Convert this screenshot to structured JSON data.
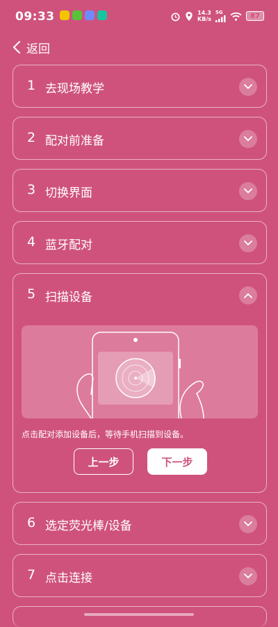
{
  "status_bar": {
    "time": "09:33",
    "net_speed_value": "14.3",
    "net_speed_unit": "KB/s",
    "signal": "5G",
    "battery": "87"
  },
  "header": {
    "back_label": "返回"
  },
  "steps": [
    {
      "num": "1",
      "title": "去现场教学",
      "expanded": false
    },
    {
      "num": "2",
      "title": "配对前准备",
      "expanded": false
    },
    {
      "num": "3",
      "title": "切换界面",
      "expanded": false
    },
    {
      "num": "4",
      "title": "蓝牙配对",
      "expanded": false
    },
    {
      "num": "5",
      "title": "扫描设备",
      "expanded": true
    },
    {
      "num": "6",
      "title": "选定荧光棒/设备",
      "expanded": false
    },
    {
      "num": "7",
      "title": "点击连接",
      "expanded": false
    }
  ],
  "expanded_step": {
    "hint": "点击配对添加设备后，等待手机扫描到设备。",
    "prev_label": "上一步",
    "next_label": "下一步"
  },
  "colors": {
    "background": "#cf527d",
    "illustration_bg": "#dd7b9d"
  }
}
